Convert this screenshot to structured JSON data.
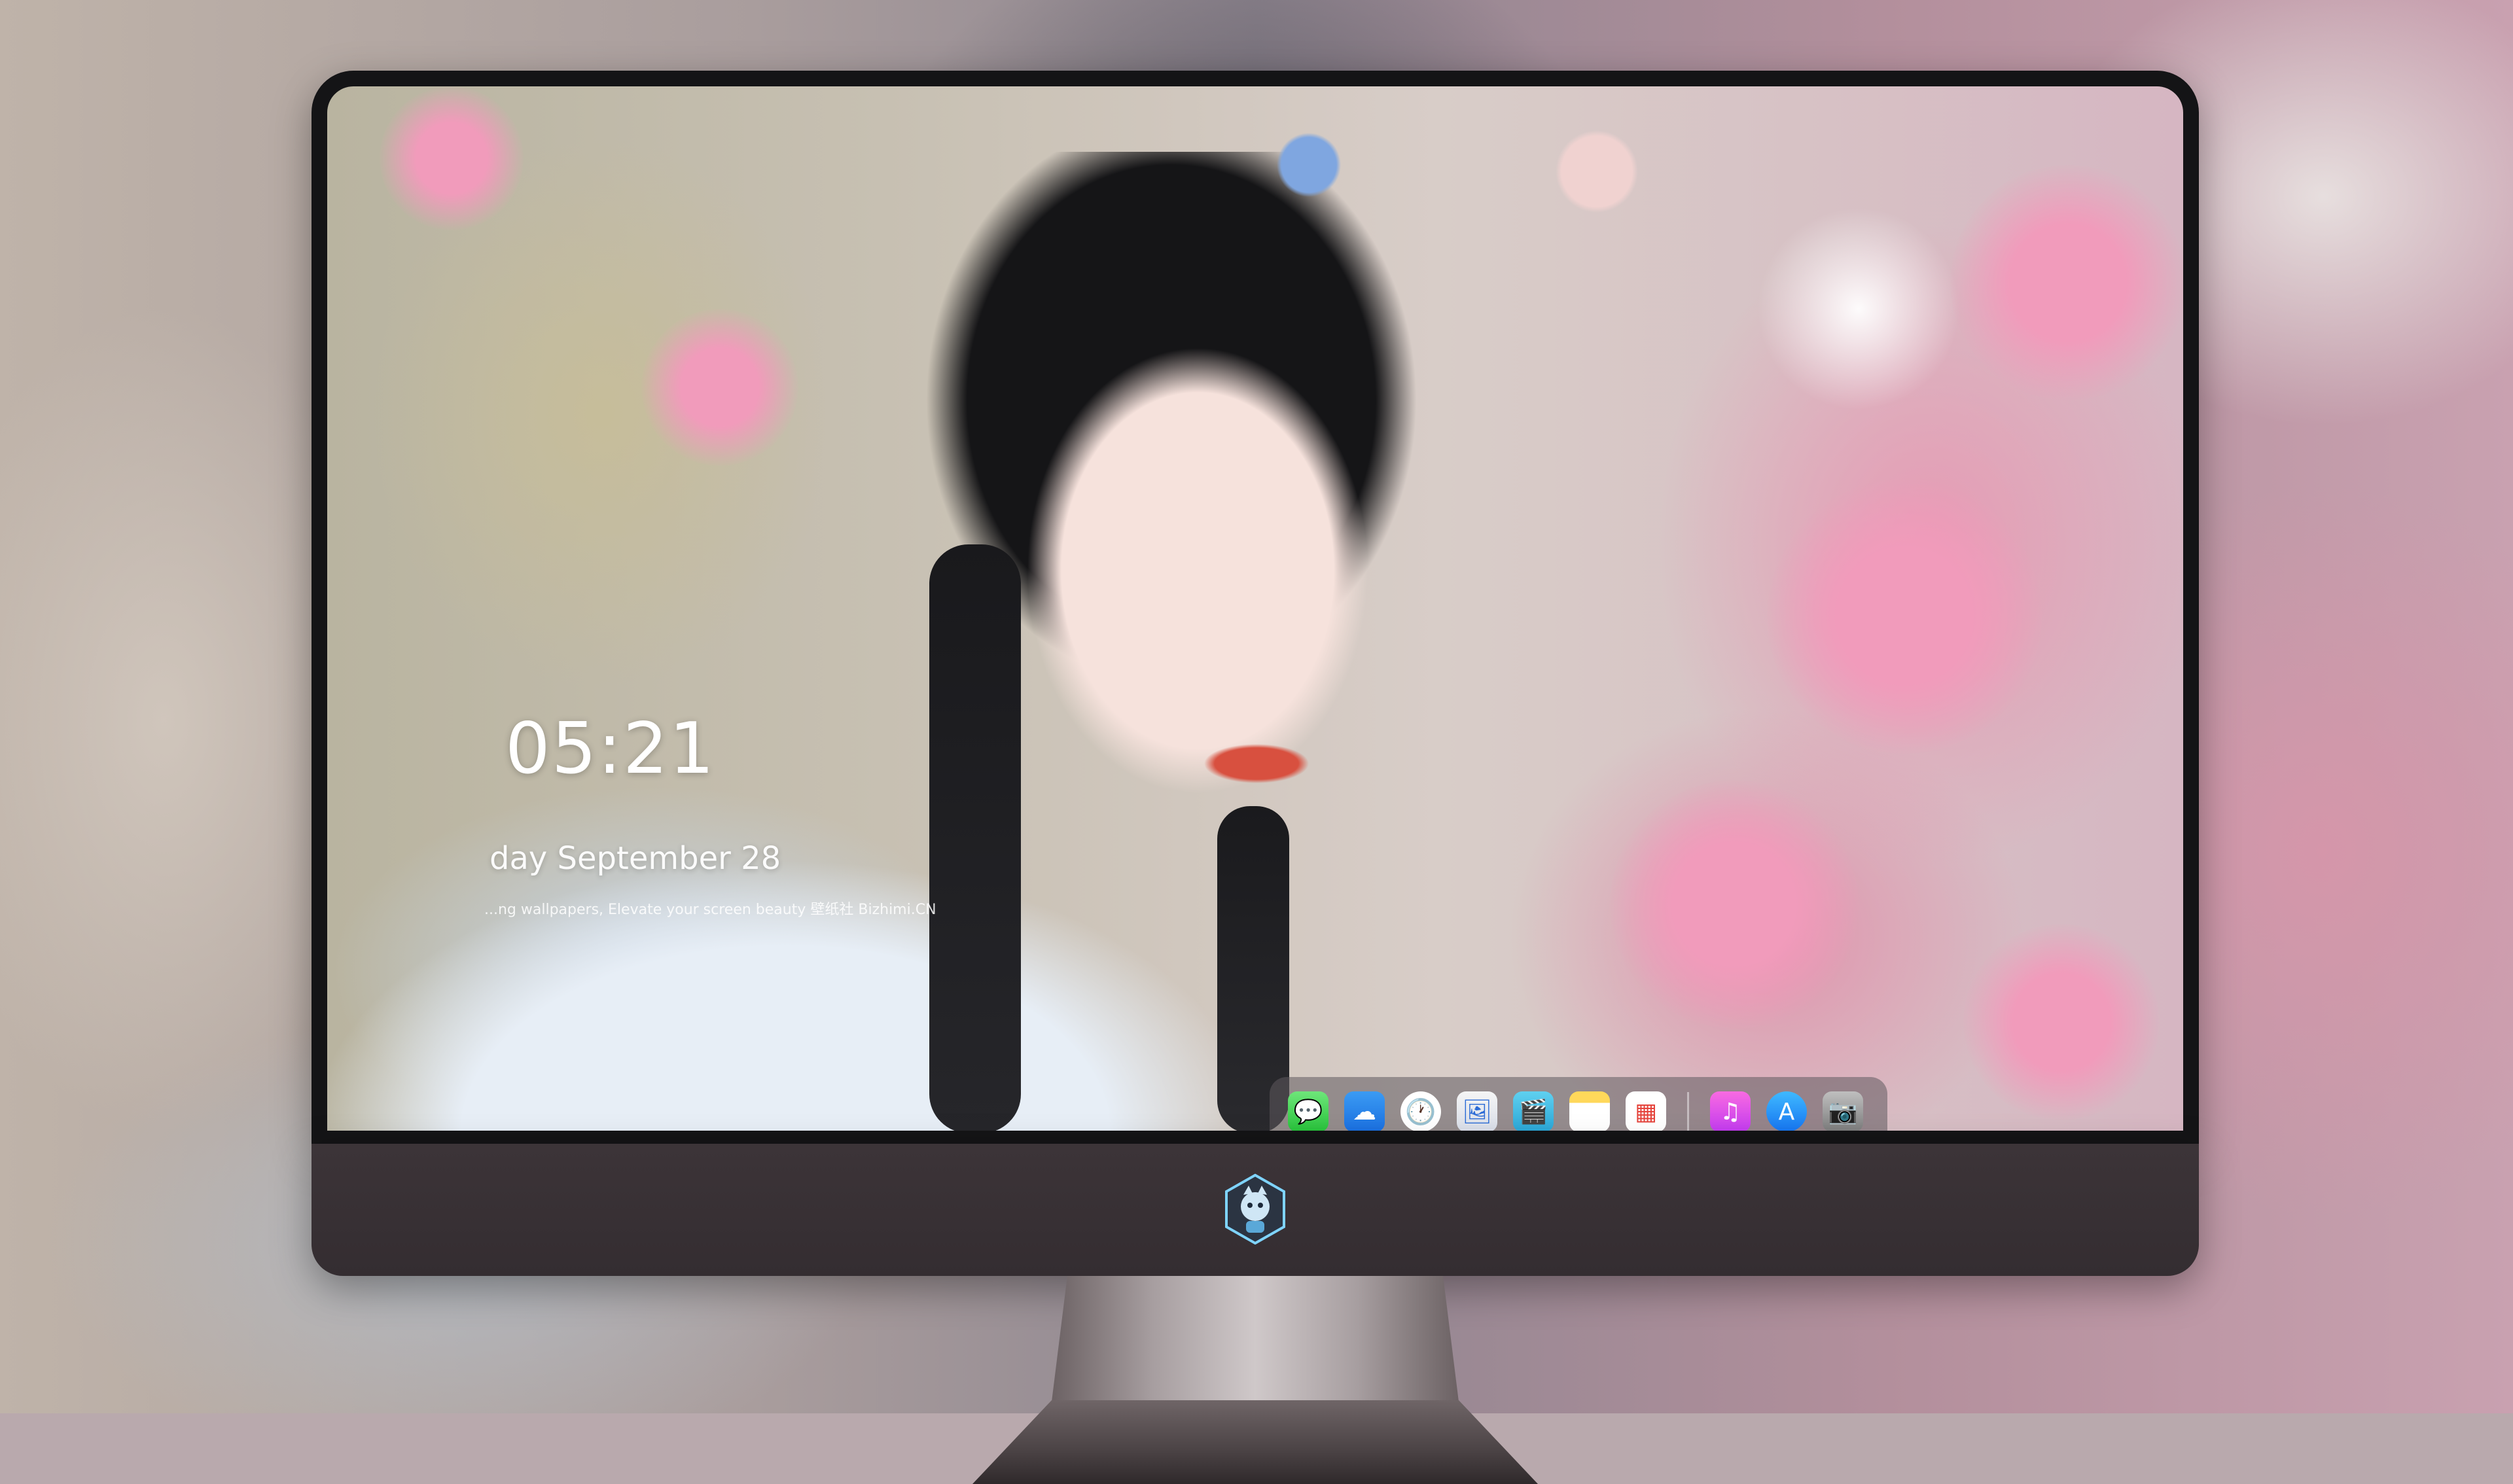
{
  "lockscreen": {
    "time": "05:21",
    "date": "day September  28",
    "tagline": "...ng wallpapers, Elevate your screen beauty  壁纸社  Bizhimi.CN"
  },
  "dock": {
    "apps": [
      {
        "name": "Messages",
        "icon": "messages-icon",
        "glyph": "💬"
      },
      {
        "name": "Weather",
        "icon": "weather-icon",
        "glyph": "☁"
      },
      {
        "name": "Clock",
        "icon": "clock-icon",
        "glyph": "🕐"
      },
      {
        "name": "Preview",
        "icon": "preview-icon",
        "glyph": "🖼"
      },
      {
        "name": "Clips",
        "icon": "clips-icon",
        "glyph": "🎬"
      },
      {
        "name": "Notes",
        "icon": "notes-icon",
        "glyph": ""
      },
      {
        "name": "Photos",
        "icon": "photos-icon",
        "glyph": "▦"
      },
      {
        "name": "Music",
        "icon": "music-icon",
        "glyph": "♫"
      },
      {
        "name": "App Store",
        "icon": "app-store-icon",
        "glyph": "A"
      },
      {
        "name": "Camera",
        "icon": "camera-icon",
        "glyph": "📷"
      }
    ]
  },
  "colors": {
    "bezel": "#141416",
    "chin": "#3a3236",
    "dock_bg": "#5f5a5e",
    "text": "#ffffff"
  }
}
